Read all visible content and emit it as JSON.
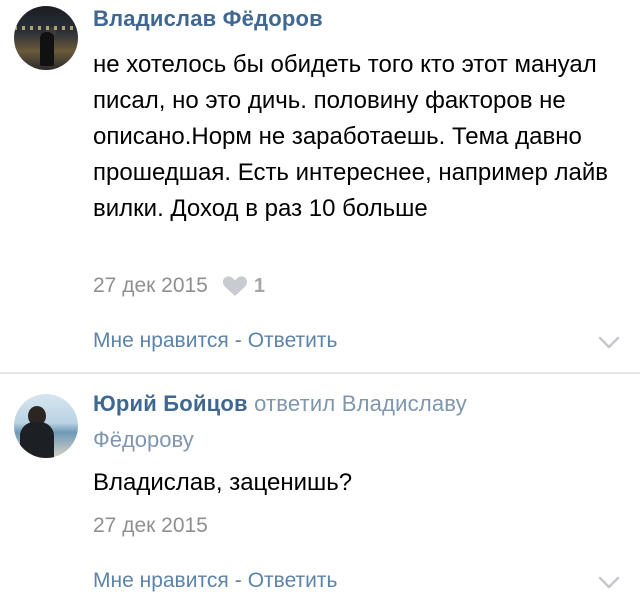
{
  "comments": [
    {
      "author": "Владислав Фёдоров",
      "text": "не хотелось бы обидеть того кто этот мануал писал, но это дичь. половину факторов не описано.Норм не заработаешь. Тема давно прошедшая. Есть интереснее, например лайв вилки. Доход в раз 10 больше",
      "date": "27 дек 2015",
      "likes": "1",
      "like_label": "Мне нравится",
      "separator": "-",
      "reply_label": "Ответить"
    },
    {
      "author": "Юрий Бойцов",
      "reply_to_prefix": "ответил Владиславу",
      "reply_to_name": "Фёдорову",
      "text": "Владислав, заценишь?",
      "date": "27 дек 2015",
      "like_label": "Мне нравится",
      "separator": "-",
      "reply_label": "Ответить"
    }
  ],
  "colors": {
    "author": "#3f6791",
    "action": "#5d83a9",
    "meta": "#8f8f93"
  }
}
